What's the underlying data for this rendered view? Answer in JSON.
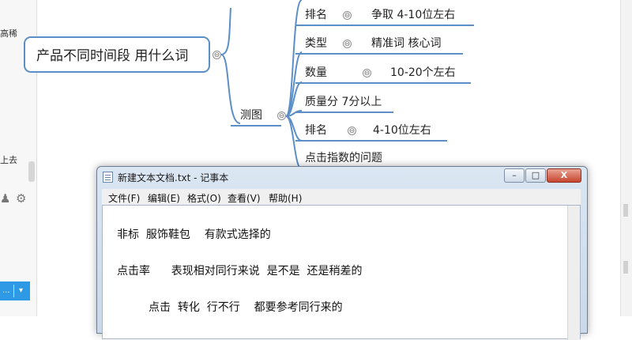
{
  "left_panel": {
    "text1": "高稀",
    "text2": "上去",
    "icon1": "users-icon",
    "icon2": "gear-icon",
    "button_arrow": "▾"
  },
  "mindmap": {
    "main_topic": "产品不同时间段 用什么词",
    "collapse_glyph": "⊖",
    "test_node": "测图",
    "top_branch": {
      "key": "排名",
      "value": "争取 4-10位左右"
    },
    "branches": [
      {
        "key": "类型",
        "value": "精准词   核心词"
      },
      {
        "key": "数量",
        "value": "10-20个左右"
      },
      {
        "key": "质量分 7分以上",
        "value": ""
      },
      {
        "key": "排名",
        "value": "4-10位左右"
      },
      {
        "key": "点击指数的问题",
        "value": ""
      }
    ]
  },
  "notepad": {
    "title": "新建文本文档.txt - 记事本",
    "menu": [
      "文件(F)",
      "编辑(E)",
      "格式(O)",
      "查看(V)",
      "帮助(H)"
    ],
    "lines": [
      "非标  服饰鞋包    有款式选择的",
      "点击率      表现相对同行来说  是不是  还是稍差的",
      "点击  转化  行不行    都要参考同行来的"
    ],
    "buttons": {
      "minimize": "–",
      "maximize": "□",
      "close": "X"
    }
  }
}
